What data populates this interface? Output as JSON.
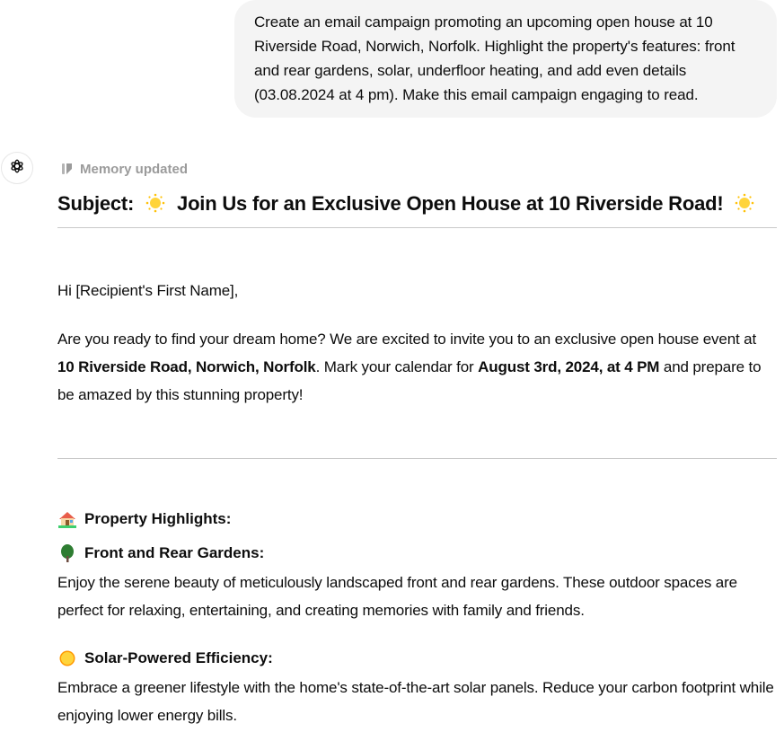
{
  "user_message": {
    "text": "Create an email campaign promoting an upcoming open house at 10 Riverside Road, Norwich, Norfolk. Highlight the property's features: front and rear gardens, solar, underfloor heating, and add even details (03.08.2024 at 4 pm). Make this email campaign engaging to read."
  },
  "assistant": {
    "avatar_icon": "openai-logo-icon",
    "memory_status": "Memory updated",
    "memory_icon": "memory-pencil-icon",
    "subject": {
      "prefix": "Subject:",
      "emoji": "glowing-star-icon",
      "title": "Join Us for an Exclusive Open House at 10 Riverside Road!"
    },
    "greeting": "Hi [Recipient's First Name],",
    "intro": {
      "part1": "Are you ready to find your dream home? We are excited to invite you to an exclusive open house event at ",
      "address": "10 Riverside Road, Norwich, Norfolk",
      "part2": ". Mark your calendar for ",
      "datetime": "August 3rd, 2024, at 4 PM",
      "part3": " and prepare to be amazed by this stunning property!"
    },
    "highlights_heading": {
      "icon": "house-with-garden-icon",
      "label": "Property Highlights:"
    },
    "features": [
      {
        "icon": "tree-icon",
        "title": "Front and Rear Gardens:",
        "description": "Enjoy the serene beauty of meticulously landscaped front and rear gardens. These outdoor spaces are perfect for relaxing, entertaining, and creating memories with family and friends."
      },
      {
        "icon": "sun-icon",
        "title": "Solar-Powered Efficiency:",
        "description": "Embrace a greener lifestyle with the home's state-of-the-art solar panels. Reduce your carbon footprint while enjoying lower energy bills."
      }
    ]
  }
}
